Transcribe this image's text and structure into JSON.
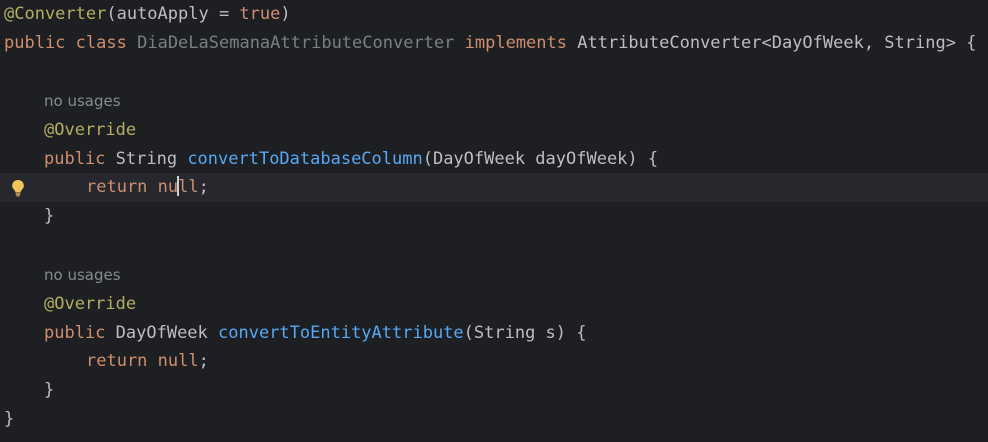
{
  "editor": {
    "lines": {
      "l1": {
        "annotation": "@Converter",
        "args": "(autoApply = ",
        "value": "true",
        "close": ")"
      },
      "l2": {
        "kw1": "public",
        "kw2": "class",
        "class_name": "DiaDeLaSemanaAttributeConverter",
        "kw3": "implements",
        "rest": "AttributeConverter<DayOfWeek, String> {"
      },
      "method1": {
        "hint": "no usages",
        "annotation": "@Override",
        "kw_public": "public",
        "return_type": " String ",
        "name": "convertToDatabaseColumn",
        "params": "(DayOfWeek dayOfWeek) {",
        "return_kw": "return",
        "null_part1": "nu",
        "null_part2": "ll",
        "semicolon": ";",
        "close": "}"
      },
      "method2": {
        "hint": "no usages",
        "annotation": "@Override",
        "kw_public": "public",
        "return_type": " DayOfWeek ",
        "name": "convertToEntityAttribute",
        "params": "(String s) {",
        "return_kw": "return",
        "null_value": "null",
        "semicolon": ";",
        "close": "}"
      },
      "class_close": "}"
    },
    "gutter_icon": "lightbulb-icon",
    "colors": {
      "background": "#1e1f22",
      "keyword": "#cf8e6d",
      "annotation": "#b3ae60",
      "method": "#56a8f5",
      "unused_class": "#7a7e85",
      "text": "#bcbec4",
      "hint": "#868a91",
      "bulb": "#f2c55c"
    }
  }
}
